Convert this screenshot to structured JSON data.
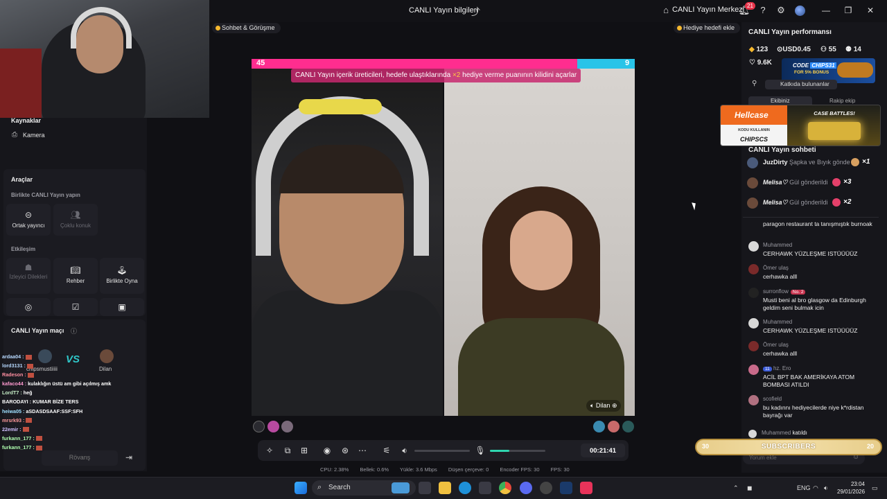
{
  "window": {
    "title": "CANLI Yayın bilgileri",
    "center_link": "CANLI Yayın Merkezi",
    "notification_count": "21"
  },
  "chips": {
    "chat_call": "Sohbet & Görüşme",
    "gift_goal": "Hediye hedefi ekle"
  },
  "left": {
    "sources_title": "Kaynaklar",
    "camera": "Kamera",
    "tools_title": "Araçlar",
    "live_together": "Birlikte CANLI Yayın yapın",
    "co_host": "Ortak yayıncı",
    "multi_guest": "Çoklu konuk",
    "interaction": "Etkileşim",
    "viewer_requests": "İzleyici Dilekleri",
    "guide": "Rehber",
    "play_together": "Birlikte Oyna",
    "match_title": "CANLI Yayın maçı",
    "player_left": "chipsmustiiiii",
    "vs": "VS",
    "player_right": "Dilan",
    "rematch": "Rövanş"
  },
  "overlay_chat": [
    {
      "user": "ardaa04 :",
      "text": ""
    },
    {
      "user": "lord3131 :",
      "text": ""
    },
    {
      "user": "Radeson :",
      "text": ""
    },
    {
      "user": "kafaco44 :",
      "text": "kulaklığın üstü am gibi açılmış amk"
    },
    {
      "user": "LordT7 :",
      "text": "heğ"
    },
    {
      "user": "BARODAYI :",
      "text": "KUMAR BİZE TERS"
    },
    {
      "user": "heiwa05 :",
      "text": "aSDASDSAAF:SSF:SFH"
    },
    {
      "user": "mrsrk93 :",
      "text": ""
    },
    {
      "user": "22emir :",
      "text": ""
    },
    {
      "user": "furkann_177 :",
      "text": ""
    },
    {
      "user": "furkann_177 :",
      "text": ""
    }
  ],
  "stream": {
    "score_left": "45",
    "score_right": "9",
    "banner_pre": "CANLI Yayın içerik üreticileri, hedefe ulaştıklarında ",
    "banner_x2": "×2",
    "banner_post": " hediye verme puanının kilidini açarlar",
    "opponent_name": "Dilan",
    "timer": "00:21:41",
    "mic_level": 0.35,
    "volume_level": 0.0
  },
  "stats": {
    "cpu": "CPU:  2.38%",
    "memory": "Bellek:  0.6%",
    "upload": "Yükle:  3.6 Mbps",
    "dropped": "Düşen çerçeve:  0",
    "encoder_fps": "Encoder FPS:  30",
    "fps": "FPS:  30"
  },
  "right": {
    "performance_title": "CANLI Yayın performansı",
    "diamonds": "123",
    "usd": "USD0.45",
    "viewers": "55",
    "gifters": "14",
    "likes": "9.6K",
    "promo_code_label": "CODE",
    "promo_code": "CHIPS31",
    "promo_bonus": "FOR 5% BONUS",
    "contributors": "Katkıda bulunanlar",
    "tab_team": "Ekibiniz",
    "tab_opponent": "Rakip ekip",
    "hellcase_logo": "Hellcase",
    "hellcase_use_code": "KODU KULLANIN",
    "hellcase_code": "CHIPSCS",
    "case_battles": "CASE BATTLES!",
    "chat_title": "CANLI Yayın sohbeti",
    "gifts": [
      {
        "name": "JuzDirty",
        "text": "Şapka ve Bıyık gönde",
        "count": "×1"
      },
      {
        "name": "Melisa♡",
        "text": "Gül gönderildi",
        "count": "×3"
      },
      {
        "name": "Melisa♡",
        "text": "Gül gönderildi",
        "count": "×2"
      }
    ],
    "messages": [
      {
        "name": "",
        "text": "paragon restaurant ta tanışmıştık burnoak"
      },
      {
        "name": "Muhammed",
        "text": "CERHAWK YÜZLEŞME ISTÜÜÜÜZ"
      },
      {
        "name": "Ömer ulaş",
        "text": "cerhawka alll"
      },
      {
        "name": "surronflow",
        "badge": "No. 2",
        "text": "Musti beni al bro glasgow da Edinburgh geldim seni bulmak icin"
      },
      {
        "name": "Muhammed",
        "text": "CERHAWK YÜZLEŞME ISTÜÜÜÜZ"
      },
      {
        "name": "Ömer ulaş",
        "text": "cerhawka alll"
      },
      {
        "name": "hz. Ero",
        "badge": "11",
        "text": "ACİL BPT BAK AMERİKAYA ATOM BOMBASI ATILDI"
      },
      {
        "name": "scofield",
        "text": "bu kadınnı hediyecilerde niye k*rdistan bayrağı var"
      },
      {
        "name": "Muhammed",
        "text": "katıldı"
      }
    ],
    "subs_label": "SUBSCRIBERS",
    "subs_left": "30",
    "subs_right": "20",
    "comment_placeholder": "Yorum ekle"
  },
  "taskbar": {
    "search": "Search",
    "lang": "ENG",
    "time": "23:04",
    "date": "29/01/2026"
  }
}
